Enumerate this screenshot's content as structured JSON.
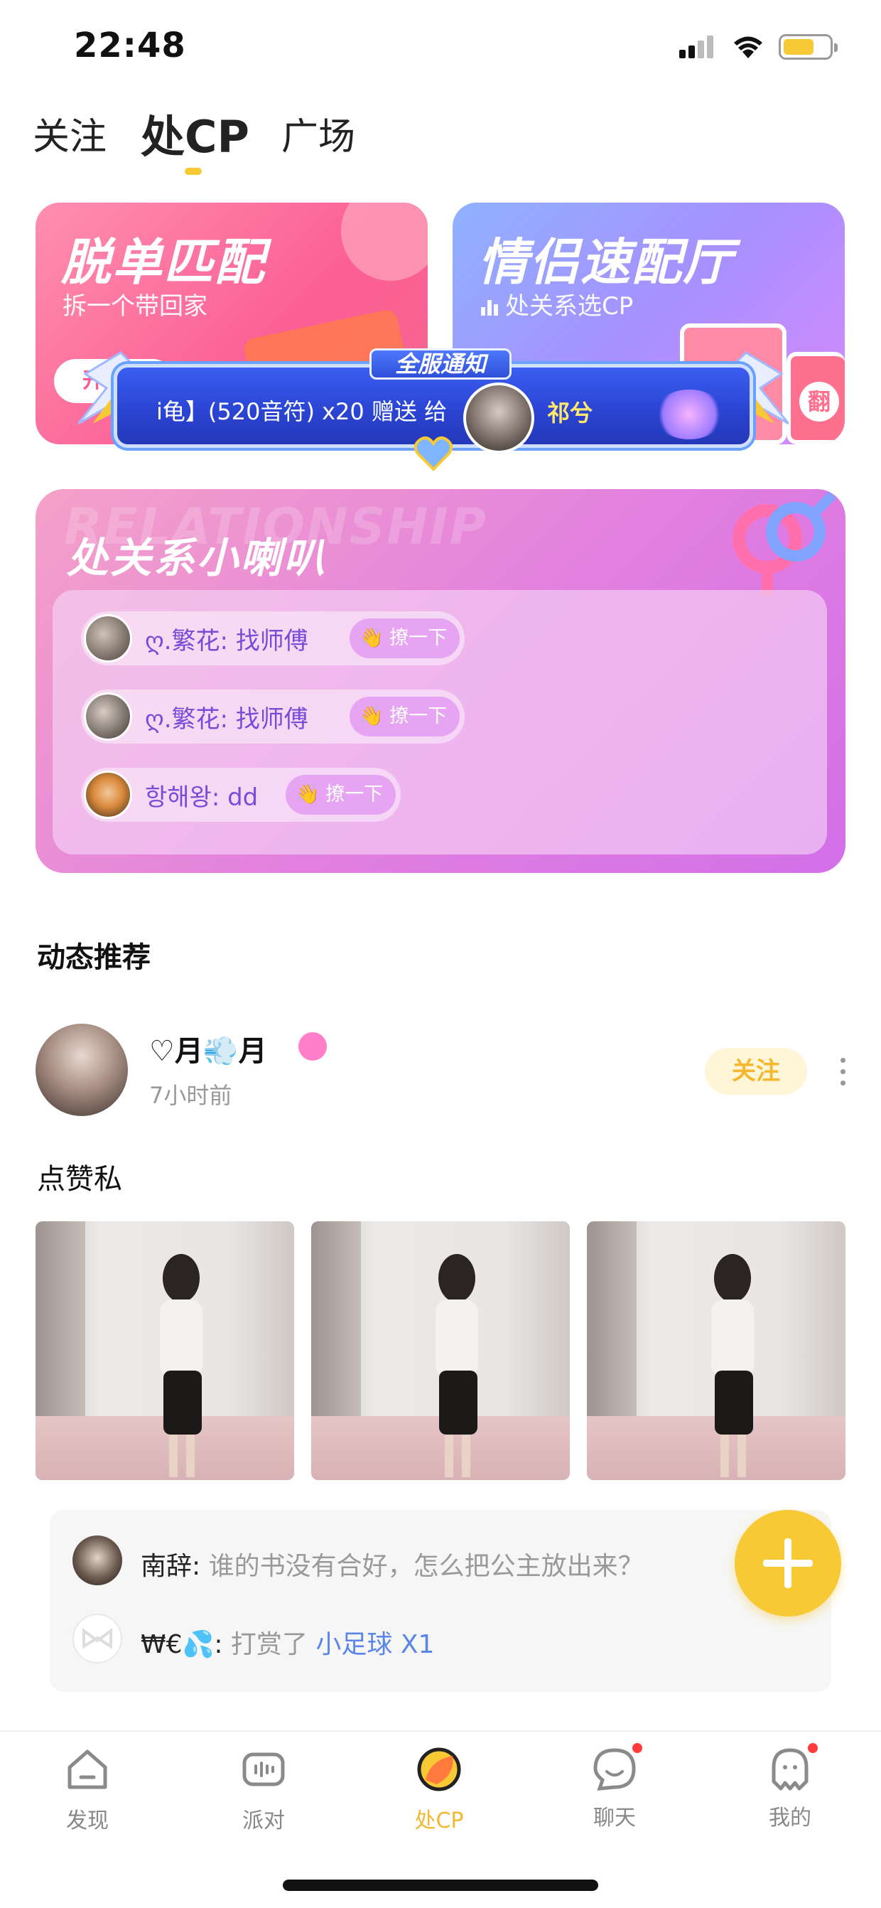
{
  "status_bar": {
    "time": "22:48"
  },
  "top_tabs": [
    {
      "label": "关注"
    },
    {
      "label": "处CP"
    },
    {
      "label": "广场"
    }
  ],
  "cards": {
    "match": {
      "title": "脱单匹配",
      "subtitle": "拆一个带回家",
      "button": "开始"
    },
    "quick": {
      "title": "情侣速配厅",
      "subtitle": "处关系选CP",
      "flip_label": "翻"
    }
  },
  "notice": {
    "title": "全服通知",
    "text": "i龟】(520音符) x20 赠送 给",
    "recipient": "祁兮"
  },
  "relationship": {
    "watermark": "RELATIONSHIP",
    "title": "处关系小喇叭",
    "items": [
      {
        "text": "ღ.繁花: 找师傅",
        "action": "👋 撩一下"
      },
      {
        "text": "ღ.繁花: 找师傅",
        "action": "👋 撩一下"
      },
      {
        "text": "항해왕: dd",
        "action": "👋 撩一下"
      }
    ]
  },
  "feed": {
    "section_title": "动态推荐",
    "post": {
      "username": "♡月💨月",
      "time": "7小时前",
      "follow": "关注",
      "text": "点赞私"
    },
    "comments": [
      {
        "name": "南辞",
        "text": "谁的书没有合好，怎么把公主放出来？"
      },
      {
        "name": "₩€💦",
        "text": "打赏了",
        "gift": "小足球 X1"
      }
    ]
  },
  "bottom_nav": [
    {
      "label": "发现",
      "icon": "discover-icon"
    },
    {
      "label": "派对",
      "icon": "party-icon"
    },
    {
      "label": "处CP",
      "icon": "cp-icon",
      "active": true
    },
    {
      "label": "聊天",
      "icon": "chat-icon",
      "badge": true
    },
    {
      "label": "我的",
      "icon": "profile-icon",
      "badge": true
    }
  ],
  "colors": {
    "accent": "#f7c934",
    "pink_card": "#fb5f94",
    "purple_card": "#a790ff",
    "panel": "#e27fe0",
    "link_blue": "#5b86e8"
  }
}
